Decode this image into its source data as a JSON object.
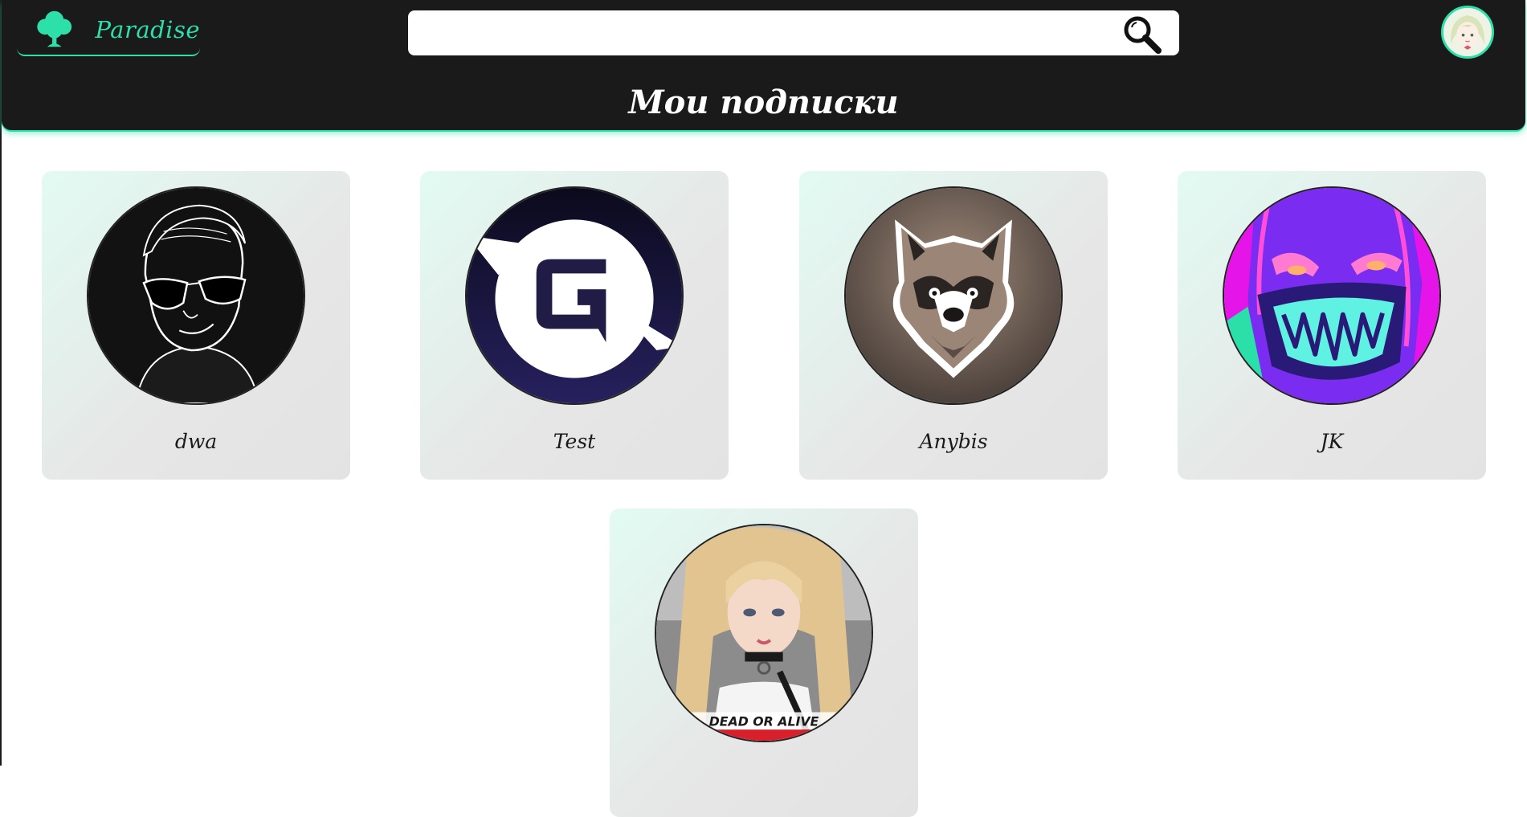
{
  "header": {
    "brand_name": "Paradise",
    "logo_icon": "tree-icon",
    "search": {
      "value": "",
      "placeholder": "",
      "icon": "search-icon"
    },
    "user_avatar": "user-avatar",
    "page_title": "Мои подписки"
  },
  "colors": {
    "accent": "#2ddfa8",
    "header_bg": "#1a1a1a",
    "card_bg_start": "#e2fbf3",
    "card_bg_end": "#e4e4e4"
  },
  "subscriptions": [
    {
      "name": "dwa",
      "avatar": "man-sunglasses-avatar"
    },
    {
      "name": "Test",
      "avatar": "g-logo-avatar"
    },
    {
      "name": "Anybis",
      "avatar": "raccoon-avatar"
    },
    {
      "name": "JK",
      "avatar": "neon-mask-avatar"
    },
    {
      "name": "",
      "avatar": "cosplay-photo-avatar",
      "image_caption": "DEAD OR ALIVE"
    }
  ]
}
